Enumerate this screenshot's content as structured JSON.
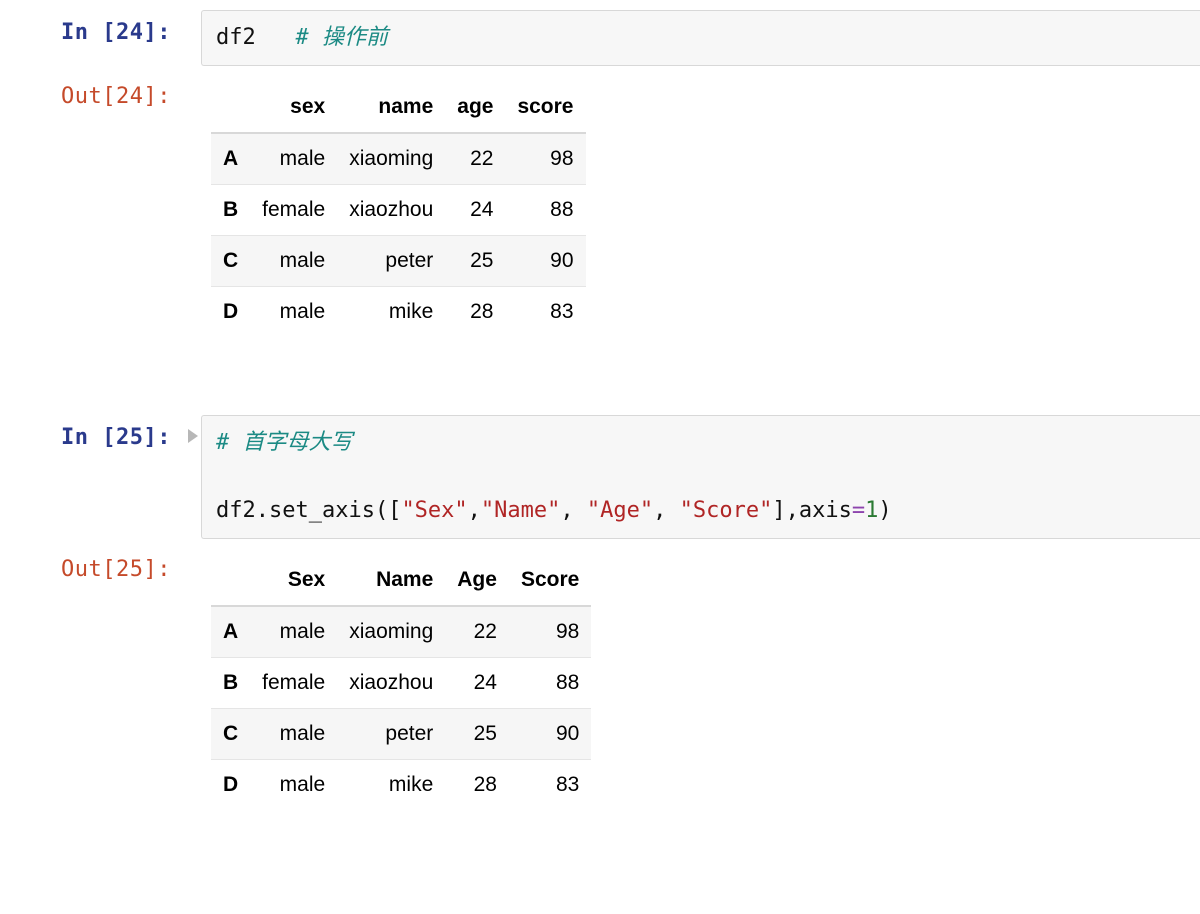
{
  "cells": [
    {
      "in_label": "In [24]:",
      "out_label": "Out[24]:",
      "show_run_toggle": false,
      "code_tokens": [
        {
          "t": "df2",
          "cls": "tok-var"
        },
        {
          "t": "   ",
          "cls": ""
        },
        {
          "t": "# 操作前",
          "cls": "tok-cmt"
        }
      ],
      "table": {
        "columns": [
          "sex",
          "name",
          "age",
          "score"
        ],
        "rows": [
          {
            "idx": "A",
            "cells": [
              "male",
              "xiaoming",
              "22",
              "98"
            ]
          },
          {
            "idx": "B",
            "cells": [
              "female",
              "xiaozhou",
              "24",
              "88"
            ]
          },
          {
            "idx": "C",
            "cells": [
              "male",
              "peter",
              "25",
              "90"
            ]
          },
          {
            "idx": "D",
            "cells": [
              "male",
              "mike",
              "28",
              "83"
            ]
          }
        ]
      }
    },
    {
      "in_label": "In [25]:",
      "out_label": "Out[25]:",
      "show_run_toggle": true,
      "code_tokens": [
        {
          "t": "# 首字母大写",
          "cls": "tok-cmt"
        },
        {
          "t": "\n\n",
          "cls": ""
        },
        {
          "t": "df2.set_axis([",
          "cls": "tok-var"
        },
        {
          "t": "\"Sex\"",
          "cls": "tok-str"
        },
        {
          "t": ",",
          "cls": "tok-var"
        },
        {
          "t": "\"Name\"",
          "cls": "tok-str"
        },
        {
          "t": ", ",
          "cls": "tok-var"
        },
        {
          "t": "\"Age\"",
          "cls": "tok-str"
        },
        {
          "t": ", ",
          "cls": "tok-var"
        },
        {
          "t": "\"Score\"",
          "cls": "tok-str"
        },
        {
          "t": "],axis",
          "cls": "tok-var"
        },
        {
          "t": "=",
          "cls": "tok-op"
        },
        {
          "t": "1",
          "cls": "tok-num"
        },
        {
          "t": ")",
          "cls": "tok-var"
        }
      ],
      "table": {
        "columns": [
          "Sex",
          "Name",
          "Age",
          "Score"
        ],
        "rows": [
          {
            "idx": "A",
            "cells": [
              "male",
              "xiaoming",
              "22",
              "98"
            ]
          },
          {
            "idx": "B",
            "cells": [
              "female",
              "xiaozhou",
              "24",
              "88"
            ]
          },
          {
            "idx": "C",
            "cells": [
              "male",
              "peter",
              "25",
              "90"
            ]
          },
          {
            "idx": "D",
            "cells": [
              "male",
              "mike",
              "28",
              "83"
            ]
          }
        ]
      }
    }
  ]
}
